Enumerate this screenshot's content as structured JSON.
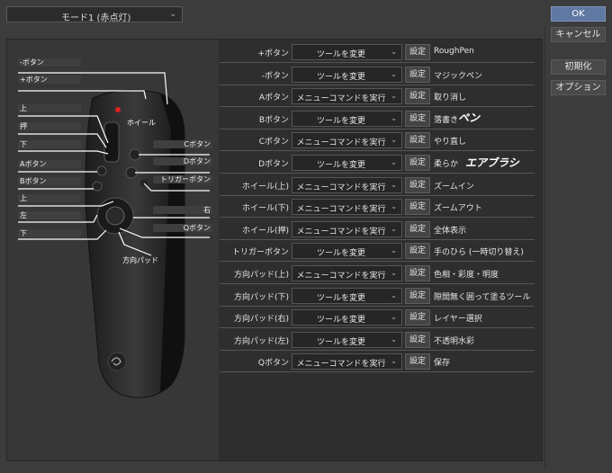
{
  "mode_select": {
    "value": "モード1 (赤点灯)"
  },
  "buttons": {
    "ok": "OK",
    "cancel": "キャンセル",
    "reset": "初期化",
    "options": "オプション"
  },
  "device_labels": {
    "plus": "+ボタン",
    "minus": "-ボタン",
    "wheel": "ホイール",
    "up1": "上",
    "push": "押",
    "down1": "下",
    "a": "Aボタン",
    "b": "Bボタン",
    "up2": "上",
    "left": "左",
    "down2": "下",
    "c": "Cボタン",
    "d": "Dボタン",
    "trigger": "トリガーボタン",
    "right": "右",
    "q": "Qボタン",
    "dpad": "方向パッド"
  },
  "rows": [
    {
      "name": "+ボタン",
      "type": "ツールを変更",
      "set": "設定",
      "value": "RoughPen"
    },
    {
      "name": "-ボタン",
      "type": "ツールを変更",
      "set": "設定",
      "value": "マジックペン"
    },
    {
      "name": "Aボタン",
      "type": "メニューコマンドを実行",
      "set": "設定",
      "value": "取り消し"
    },
    {
      "name": "Bボタン",
      "type": "ツールを変更",
      "set": "設定",
      "value": "落書き"
    },
    {
      "name": "Cボタン",
      "type": "メニューコマンドを実行",
      "set": "設定",
      "value": "やり直し"
    },
    {
      "name": "Dボタン",
      "type": "ツールを変更",
      "set": "設定",
      "value": "柔らか"
    },
    {
      "name": "ホイール(上)",
      "type": "メニューコマンドを実行",
      "set": "設定",
      "value": "ズームイン"
    },
    {
      "name": "ホイール(下)",
      "type": "メニューコマンドを実行",
      "set": "設定",
      "value": "ズームアウト"
    },
    {
      "name": "ホイール(押)",
      "type": "メニューコマンドを実行",
      "set": "設定",
      "value": "全体表示"
    },
    {
      "name": "トリガーボタン",
      "type": "ツールを変更",
      "set": "設定",
      "value": "手のひら (一時切り替え)"
    },
    {
      "name": "方向パッド(上)",
      "type": "メニューコマンドを実行",
      "set": "設定",
      "value": "色相・彩度・明度"
    },
    {
      "name": "方向パッド(下)",
      "type": "ツールを変更",
      "set": "設定",
      "value": "隙間無く囲って塗るツール"
    },
    {
      "name": "方向パッド(右)",
      "type": "ツールを変更",
      "set": "設定",
      "value": "レイヤー選択"
    },
    {
      "name": "方向パッド(左)",
      "type": "ツールを変更",
      "set": "設定",
      "value": "不透明水彩"
    },
    {
      "name": "Qボタン",
      "type": "メニューコマンドを実行",
      "set": "設定",
      "value": "保存"
    }
  ],
  "handwritten": {
    "pen": "ペン",
    "airbrush": "エアブラシ"
  }
}
